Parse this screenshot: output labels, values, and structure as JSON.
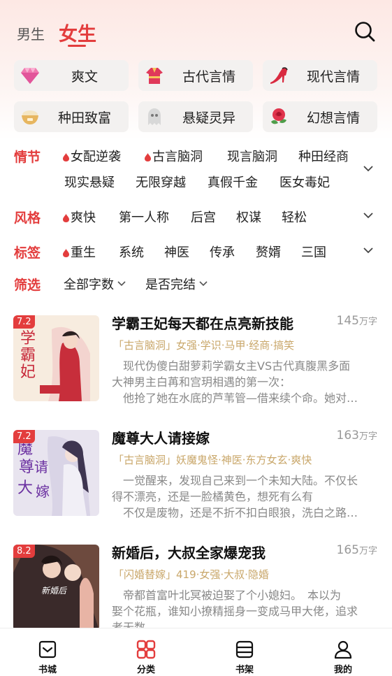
{
  "header": {
    "tab_male": "男生",
    "tab_female": "女生",
    "accent": "#e33d3d"
  },
  "categories": [
    {
      "label": "爽文",
      "icon": "diamond-icon"
    },
    {
      "label": "古代言情",
      "icon": "hanfu-icon"
    },
    {
      "label": "现代言情",
      "icon": "high-heel-icon"
    },
    {
      "label": "种田致富",
      "icon": "rice-bowl-icon"
    },
    {
      "label": "悬疑灵异",
      "icon": "ghost-icon"
    },
    {
      "label": "幻想言情",
      "icon": "rose-icon"
    }
  ],
  "filters": {
    "plot": {
      "key": "情节",
      "row1": [
        "女配逆袭",
        "古言脑洞",
        "现言脑洞",
        "种田经商"
      ],
      "row2": [
        "现实悬疑",
        "无限穿越",
        "真假千金",
        "医女毒妃"
      ]
    },
    "style": {
      "key": "风格",
      "items": [
        "爽快",
        "第一人称",
        "后宫",
        "权谋",
        "轻松"
      ]
    },
    "tags": {
      "key": "标签",
      "items": [
        "重生",
        "系统",
        "神医",
        "传承",
        "赘婿",
        "三国"
      ]
    },
    "screen": {
      "key": "筛选",
      "word_count": "全部字数",
      "finished": "是否完结"
    }
  },
  "books": [
    {
      "score": "7.2",
      "title": "学霸王妃每天都在点亮新技能",
      "words": "145",
      "words_unit": "万字",
      "tags": "「古言脑洞」女强·学识·马甲·经商·搞笑",
      "desc1": "　现代伪傻白甜萝莉学霸女主VS古代真腹黑多面",
      "desc2": "大神男主白苒和宫玥相遇的第一次：",
      "desc3": "　他抢了她在水底的芦苇管—借来续个命。她对…"
    },
    {
      "score": "7.2",
      "title": "魔尊大人请接嫁",
      "words": "163",
      "words_unit": "万字",
      "tags": "「古言脑洞」妖魔鬼怪·神医·东方女玄·爽快",
      "desc1": "　一觉醒来，发现自己来到一个未知大陆。不仅长",
      "desc2": "得不漂亮，还是一脸橘黄色，想死有么有",
      "desc3": "　不仅是废物，还是不折不扣白眼狼，洗白之路…"
    },
    {
      "score": "8.2",
      "title": "新婚后，大叔全家爆宠我",
      "words": "165",
      "words_unit": "万字",
      "tags": "「闪婚替嫁」419·女强·大叔·隐婚",
      "desc1": "　帝都首富叶北冥被迫娶了个小媳妇。　本以为",
      "desc2": "娶个花瓶，谁知小撩精摇身一变成马甲大佬，追求",
      "desc3": "者无数"
    }
  ],
  "bottom_nav": [
    {
      "label": "书城",
      "icon": "bookstore-icon"
    },
    {
      "label": "分类",
      "icon": "category-grid-icon",
      "active": true
    },
    {
      "label": "书架",
      "icon": "bookshelf-icon"
    },
    {
      "label": "我的",
      "icon": "profile-icon"
    }
  ]
}
